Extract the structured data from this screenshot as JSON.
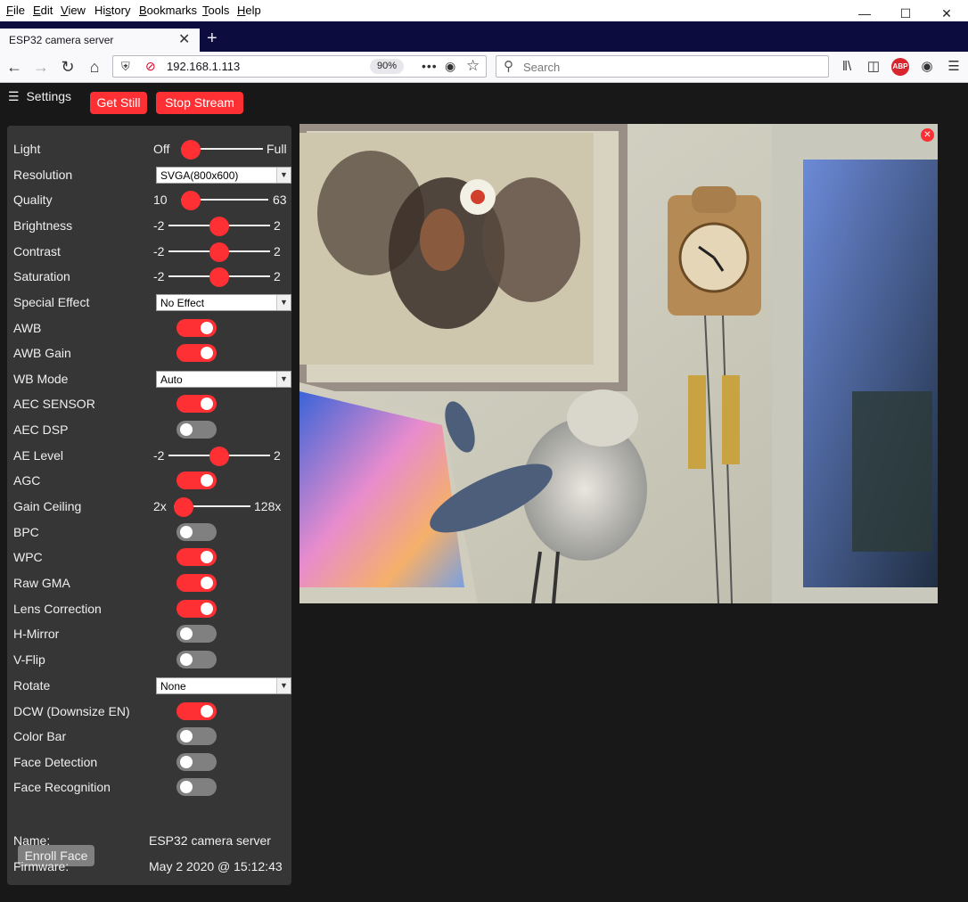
{
  "browser": {
    "menu": [
      "File",
      "Edit",
      "View",
      "History",
      "Bookmarks",
      "Tools",
      "Help"
    ],
    "menu_mnemonic": [
      "F",
      "E",
      "V",
      "s",
      "B",
      "T",
      "H"
    ],
    "tab_title": "ESP32 camera server",
    "url": "192.168.1.113",
    "zoom": "90%",
    "search_placeholder": "Search",
    "abp_label": "ABP"
  },
  "page": {
    "settings_label": "Settings",
    "get_still": "Get Still",
    "stop_stream": "Stop Stream",
    "controls": [
      {
        "label": "Light",
        "type": "range",
        "min_label": "Off",
        "max_label": "Full",
        "value_fraction": 0.0
      },
      {
        "label": "Resolution",
        "type": "select",
        "value": "SVGA(800x600)"
      },
      {
        "label": "Quality",
        "type": "range",
        "min_label": "10",
        "max_label": "63",
        "value": 10,
        "min": 10,
        "max": 63
      },
      {
        "label": "Brightness",
        "type": "range",
        "min_label": "-2",
        "max_label": "2",
        "value": 0,
        "min": -2,
        "max": 2
      },
      {
        "label": "Contrast",
        "type": "range",
        "min_label": "-2",
        "max_label": "2",
        "value": 0,
        "min": -2,
        "max": 2
      },
      {
        "label": "Saturation",
        "type": "range",
        "min_label": "-2",
        "max_label": "2",
        "value": 0,
        "min": -2,
        "max": 2
      },
      {
        "label": "Special Effect",
        "type": "select",
        "value": "No Effect"
      },
      {
        "label": "AWB",
        "type": "toggle",
        "on": true
      },
      {
        "label": "AWB Gain",
        "type": "toggle",
        "on": true
      },
      {
        "label": "WB Mode",
        "type": "select",
        "value": "Auto"
      },
      {
        "label": "AEC SENSOR",
        "type": "toggle",
        "on": true
      },
      {
        "label": "AEC DSP",
        "type": "toggle",
        "on": false
      },
      {
        "label": "AE Level",
        "type": "range",
        "min_label": "-2",
        "max_label": "2",
        "value": 0,
        "min": -2,
        "max": 2
      },
      {
        "label": "AGC",
        "type": "toggle",
        "on": true
      },
      {
        "label": "Gain Ceiling",
        "type": "range",
        "min_label": "2x",
        "max_label": "128x",
        "value_fraction": 0.0
      },
      {
        "label": "BPC",
        "type": "toggle",
        "on": false
      },
      {
        "label": "WPC",
        "type": "toggle",
        "on": true
      },
      {
        "label": "Raw GMA",
        "type": "toggle",
        "on": true
      },
      {
        "label": "Lens Correction",
        "type": "toggle",
        "on": true
      },
      {
        "label": "H-Mirror",
        "type": "toggle",
        "on": false
      },
      {
        "label": "V-Flip",
        "type": "toggle",
        "on": false
      },
      {
        "label": "Rotate",
        "type": "select",
        "value": "None"
      },
      {
        "label": "DCW (Downsize EN)",
        "type": "toggle",
        "on": true
      },
      {
        "label": "Color Bar",
        "type": "toggle",
        "on": false
      },
      {
        "label": "Face Detection",
        "type": "toggle",
        "on": false
      },
      {
        "label": "Face Recognition",
        "type": "toggle",
        "on": false
      }
    ],
    "enroll_face": "Enroll Face",
    "name_label": "Name:",
    "name_value": "ESP32 camera server",
    "firmware_label": "Firmware:",
    "firmware_value": "May 2 2020 @ 15:12:43"
  },
  "colors": {
    "accent": "#ff3034",
    "panel": "#363636",
    "background": "#181818",
    "toggle_off": "#808080"
  }
}
